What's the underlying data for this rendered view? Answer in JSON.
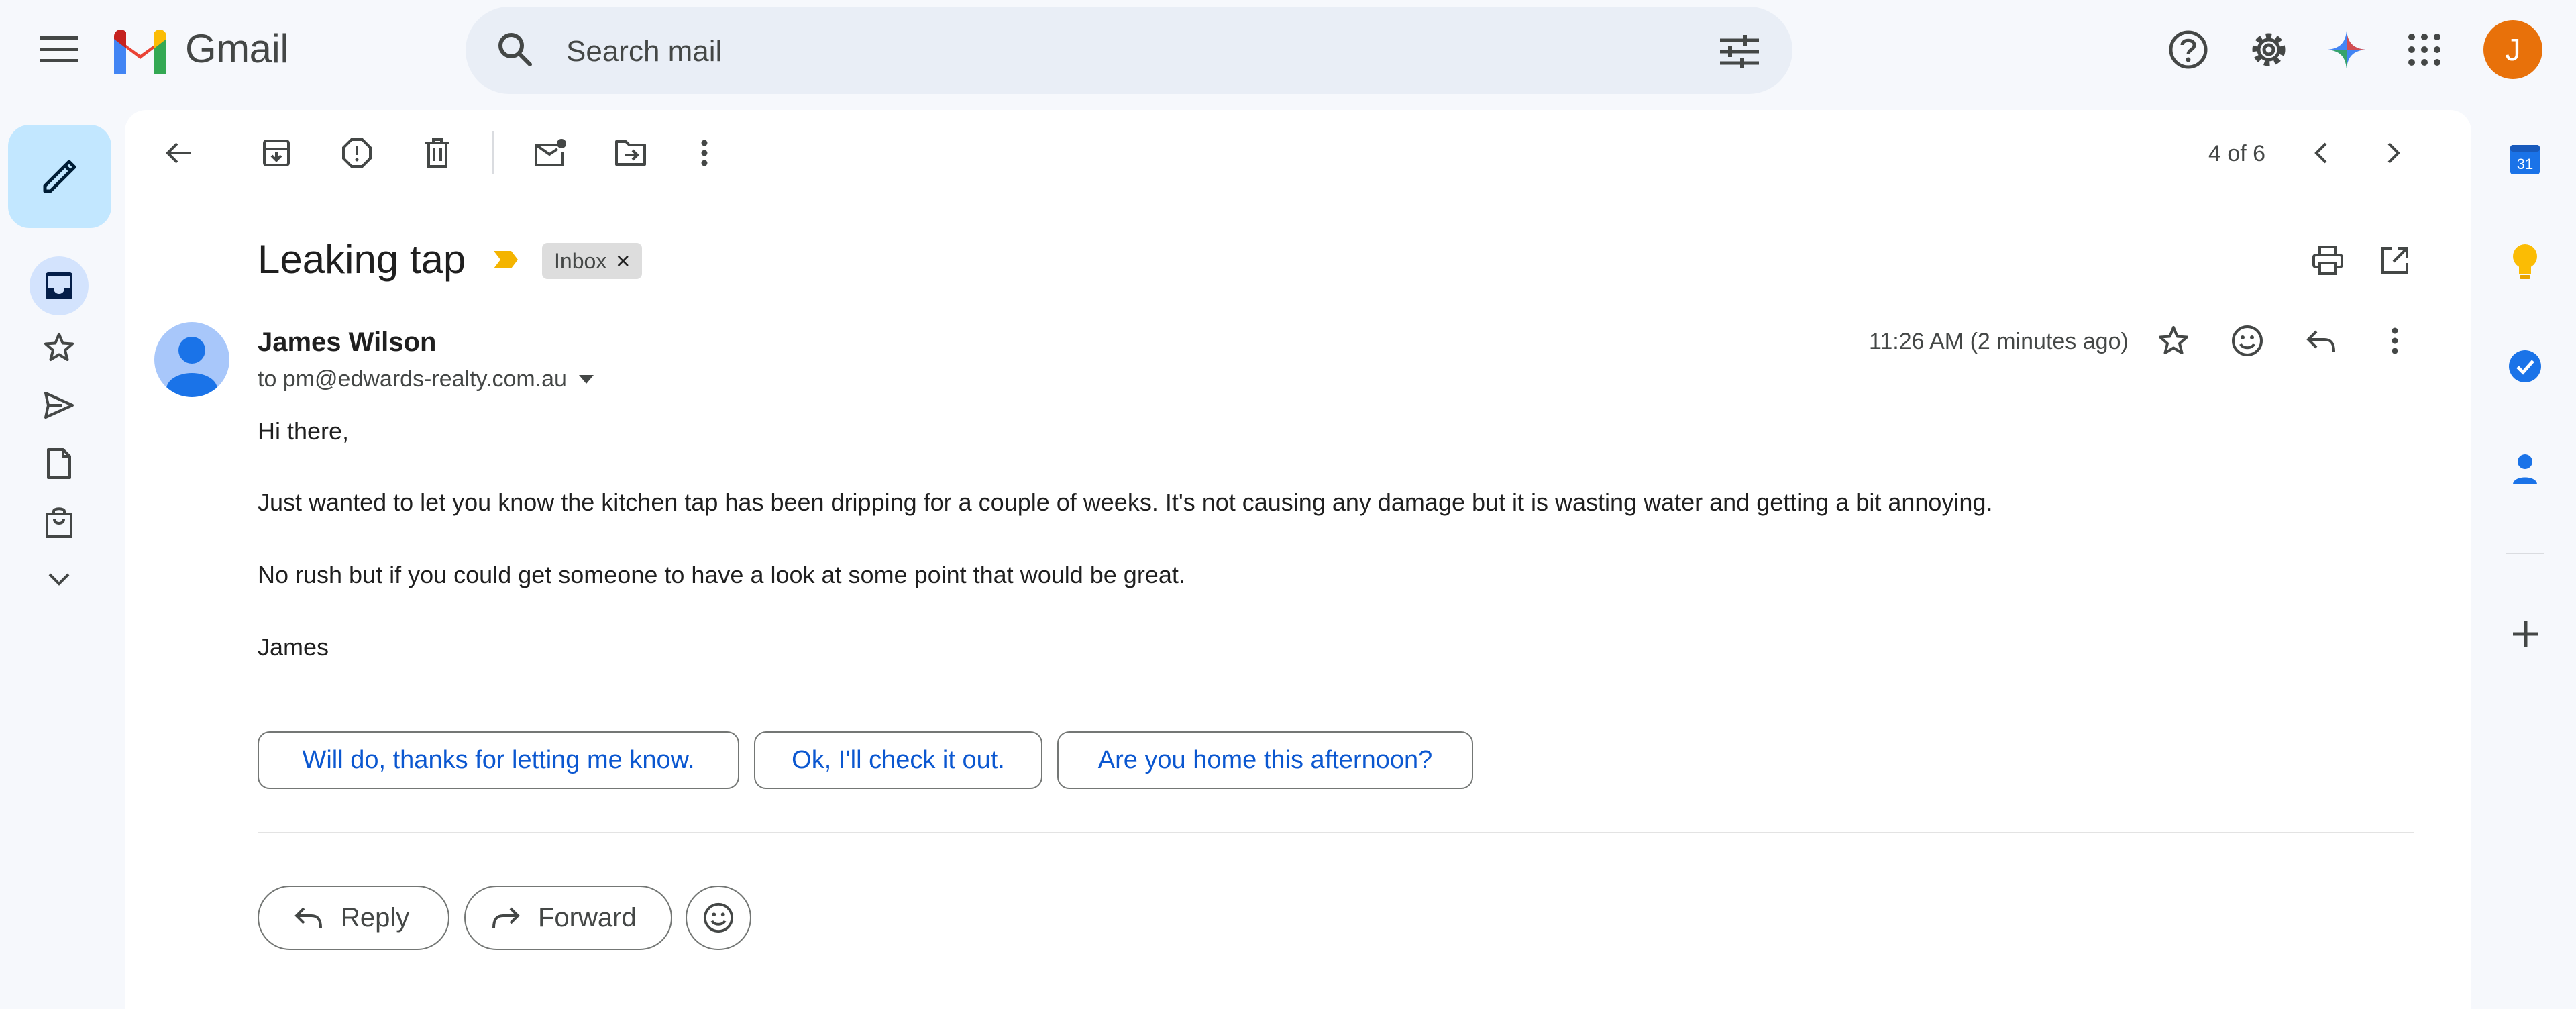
{
  "app": {
    "name": "Gmail"
  },
  "search": {
    "placeholder": "Search mail"
  },
  "account": {
    "initial": "J",
    "color": "#e8710a"
  },
  "pager": {
    "text": "4 of 6"
  },
  "email": {
    "subject": "Leaking tap",
    "label": "Inbox",
    "label_close": "×",
    "sender": "James Wilson",
    "to": "to pm@edwards-realty.com.au",
    "time": "11:26 AM (2 minutes ago)",
    "body": [
      "Hi there,",
      "Just wanted to let you know the kitchen tap has been dripping for a couple of weeks. It's not causing any damage but it is wasting water and getting a bit annoying.",
      "No rush but if you could get someone to have a look at some point that would be great.",
      "James"
    ]
  },
  "smart_replies": [
    "Will do, thanks for letting me know.",
    "Ok, I'll check it out.",
    "Are you home this afternoon?"
  ],
  "actions": {
    "reply": "Reply",
    "forward": "Forward"
  },
  "right_panel": {
    "calendar_date": "31"
  },
  "colors": {
    "accent": "#0b57d0",
    "compose_bg": "#c2e7ff",
    "background": "#f6f8fc"
  }
}
